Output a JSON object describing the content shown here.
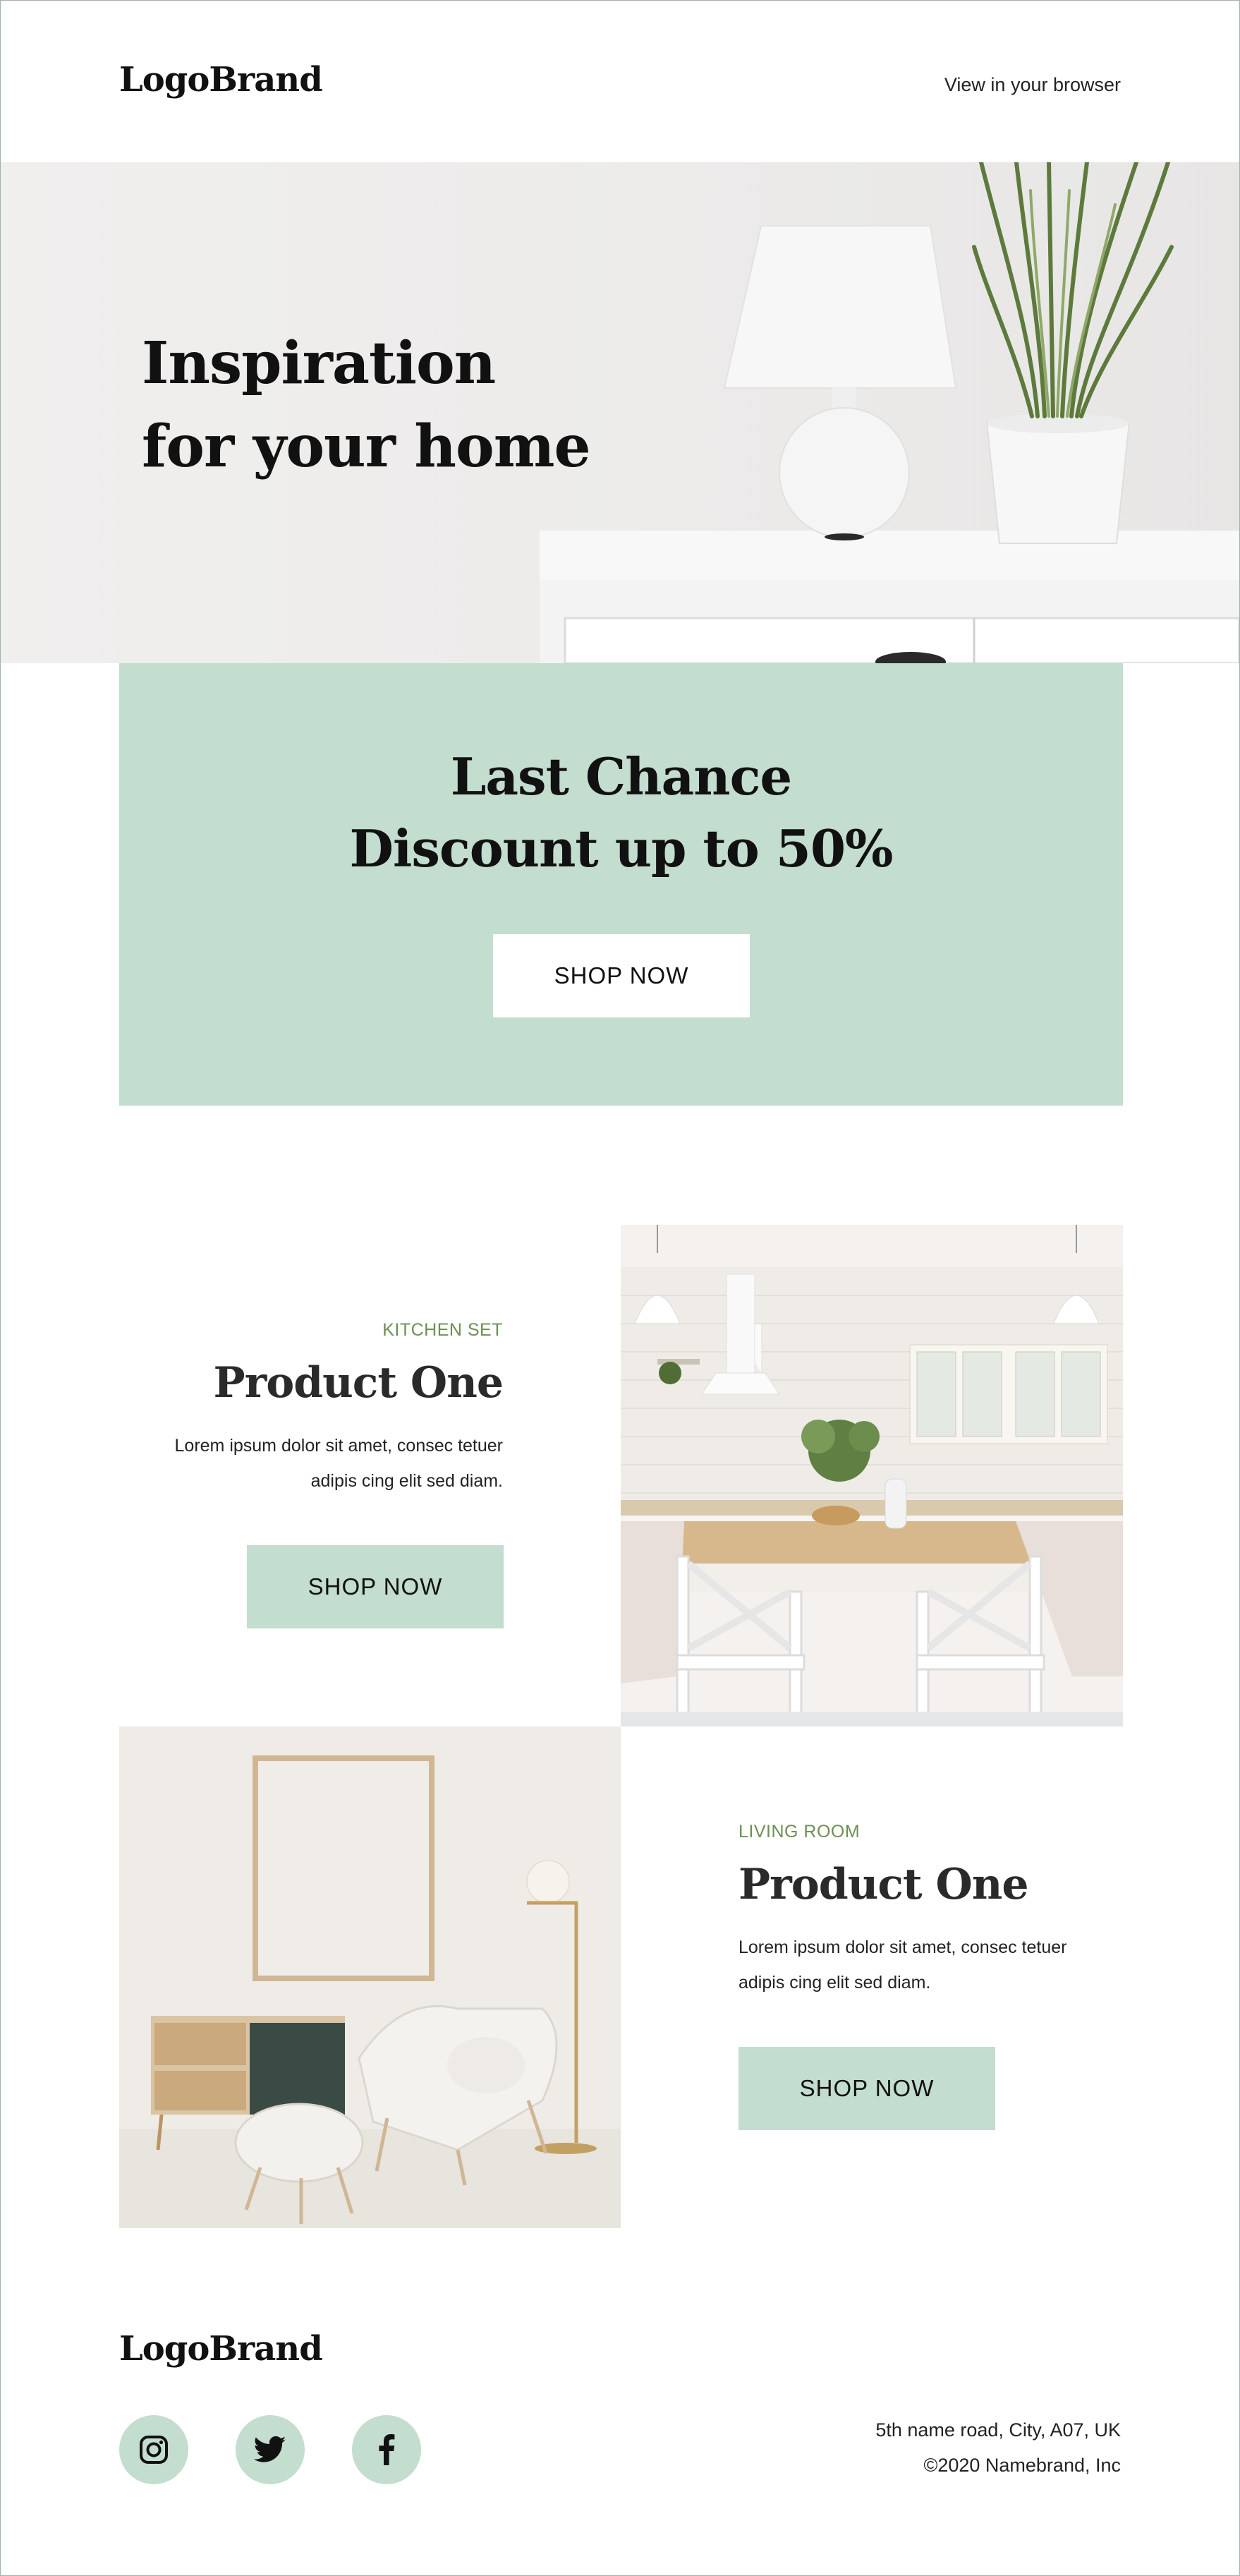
{
  "header": {
    "logo": "LogoBrand",
    "view_in_browser": "View in your browser"
  },
  "hero": {
    "title_line1": "Inspiration",
    "title_line2": "for your home"
  },
  "promo": {
    "line1": "Last Chance",
    "line2": "Discount up to 50%",
    "button_label": "SHOP NOW"
  },
  "products": [
    {
      "category": "KITCHEN SET",
      "title": "Product One",
      "description_line1": "Lorem ipsum dolor sit amet, consec tetuer",
      "description_line2": "adipis cing elit sed diam.",
      "button_label": "SHOP NOW"
    },
    {
      "category": "LIVING ROOM",
      "title": "Product One",
      "description_line1": "Lorem ipsum dolor sit amet, consec tetuer",
      "description_line2": "adipis cing elit sed diam.",
      "button_label": "SHOP NOW"
    }
  ],
  "footer": {
    "logo": "LogoBrand",
    "address": "5th name road, City, A07, UK",
    "copyright": "©2020 Namebrand, Inc",
    "social": [
      {
        "icon": "instagram-icon"
      },
      {
        "icon": "twitter-icon"
      },
      {
        "icon": "facebook-icon"
      }
    ]
  },
  "colors": {
    "accent_mint": "#c3ddcf",
    "eyebrow_green": "#6e8f55",
    "text_dark": "#111111"
  }
}
